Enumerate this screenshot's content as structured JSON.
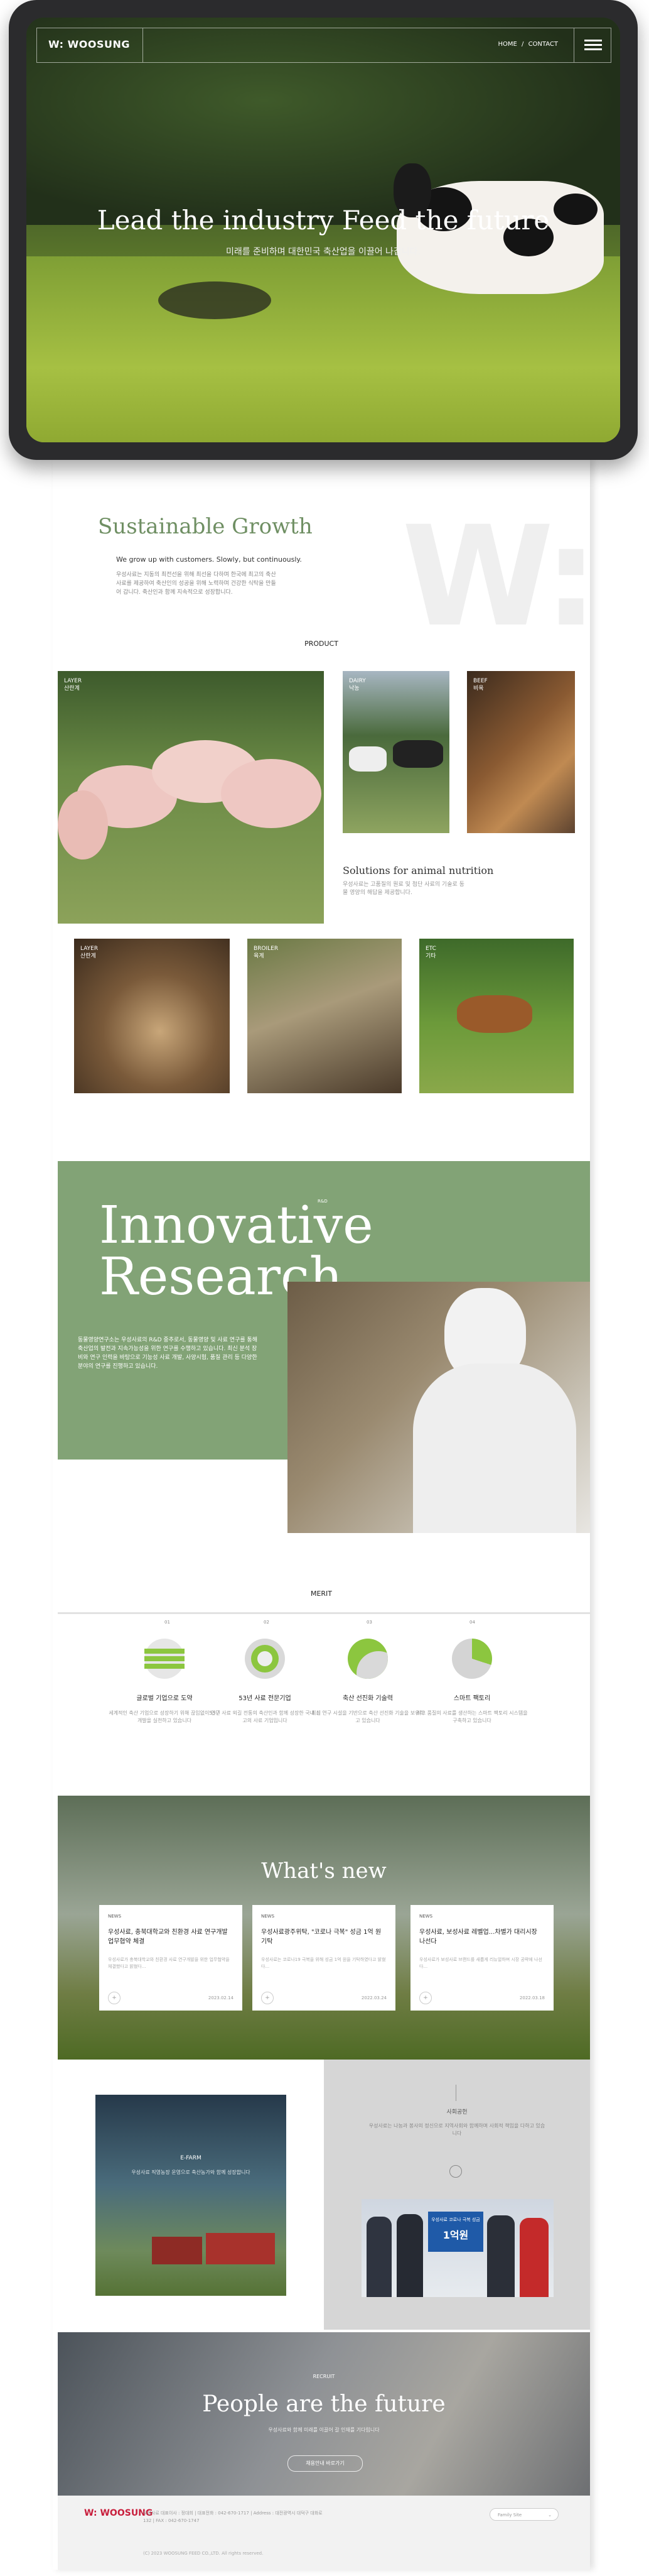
{
  "header": {
    "logo": "W: WOOSUNG",
    "nav_home": "HOME",
    "nav_sep": "/",
    "nav_contact": "CONTACT"
  },
  "hero": {
    "title": "Lead the industry Feed the future",
    "subtitle": "미래를 준비하며 대한민국 축산업을 이끌어 나갑니다."
  },
  "sustainable": {
    "watermark": "W:",
    "title": "Sustainable Growth",
    "subtitle": "We grow up with customers. Slowly, but continuously.",
    "body": "우성사료는 지동의 최전선을 위해 최선을 다하며 한국에 최고의 축산사료를 제공하여 축산인의 성공을 위해 노력하며 건강한 식탁을 만들어 갑니다. 축산인과 함께 지속적으로 성장합니다."
  },
  "product": {
    "label": "PRODUCT",
    "tiles": [
      {
        "en": "LAYER",
        "ko": "산란계"
      },
      {
        "en": "DAIRY",
        "ko": "낙농"
      },
      {
        "en": "BEEF",
        "ko": "비육"
      },
      {
        "en": "LAYER",
        "ko": "산란계"
      },
      {
        "en": "BROILER",
        "ko": "육계"
      },
      {
        "en": "ETC",
        "ko": "기타"
      }
    ],
    "solution_title": "Solutions for animal nutrition",
    "solution_body": "우성사료는 고품질의 원료 및 첨단 사료의 기술로 동물 영양의 해답을 제공합니다."
  },
  "research": {
    "small_label": "R&D",
    "title_line1": "Innovative",
    "title_line2": "Research",
    "body": "동물영양연구소는 우성사료의 R&D 중추로서, 동물영양 및 사료 연구를 통해 축산업의 발전과 지속가능성을 위한 연구를 수행하고 있습니다. 최신 분석 장비와 연구 인력을 바탕으로 기능성 사료 개발, 사양시험, 품질 관리 등 다양한 분야의 연구를 진행하고 있습니다."
  },
  "merit": {
    "label": "MERIT",
    "ticks": [
      "01",
      "02",
      "03",
      "04"
    ],
    "items": [
      {
        "icon": "stripes-icon",
        "title": "글로벌 기업으로 도약",
        "body": "세계적인 축산 기업으로 성장하기 위해 끊임없이 연구 개발을 실천하고 있습니다"
      },
      {
        "icon": "target-ring-icon",
        "title": "53년 사료 전문기업",
        "body": "53년 사료 외길 전통의 축산인과 함께 성장한 국내 최고의 사료 기업입니다"
      },
      {
        "icon": "swoosh-icon",
        "title": "축산 선진화 기술력",
        "body": "최신 연구 시설을 기반으로 축산 선진화 기술을 보유하고 있습니다"
      },
      {
        "icon": "pie-icon",
        "title": "스마트 팩토리",
        "body": "최고 품질의 사료를 생산하는 스마트 팩토리 시스템을 구축하고 있습니다"
      }
    ]
  },
  "news": {
    "title": "What's new",
    "cards": [
      {
        "tag": "NEWS",
        "title": "우성사료, 충북대학교와 친환경 사료 연구개발 업무협약 체결",
        "body": "우성사료가 충북대학교와 친환경 사료 연구개발을 위한 업무협약을 체결했다고 밝혔다...",
        "more": "+",
        "date": "2023.02.14"
      },
      {
        "tag": "NEWS",
        "title": "우성사료광주위탁, \"코로나 극복\" 성금 1억 원 기탁",
        "body": "우성사료는 코로나19 극복을 위해 성금 1억 원을 기탁하였다고 밝혔다...",
        "more": "+",
        "date": "2022.03.24"
      },
      {
        "tag": "NEWS",
        "title": "우성사료, 보성사료 레벨업...차별가 대리시장 나선다",
        "body": "우성사료가 보성사료 브랜드를 새롭게 리뉴얼하며 시장 공략에 나선다...",
        "more": "+",
        "date": "2022.03.18"
      }
    ]
  },
  "farm": {
    "label": "E-FARM",
    "body": "우성사료 직영농장 운영으로 축산농가와 함께 성장합니다"
  },
  "donate": {
    "label": "사회공헌",
    "body": "우성사료는 나눔과 봉사의 정신으로 지역사회와 함께하며 사회적 책임을 다하고 있습니다",
    "board_title": "우성사료 코로나 극복 성금",
    "board_amount": "1억원"
  },
  "recruit": {
    "label": "RECRUIT",
    "title": "People are the future",
    "body": "우성사료와 함께 미래를 이끌어 갈 인재를 기다립니다",
    "button": "채용안내 바로가기"
  },
  "footer": {
    "logo": "W: WOOSUNG",
    "info": "우성사료 대표이사 : 정대희  |  대표전화 : 042-670-1717  |  Address : 대전광역시 대덕구 대화로 132  |  FAX : 042-670-1747",
    "family_site": "Family Site",
    "copyright": "(C) 2023 WOOSUNG FEED CO.,LTD. All rights reserved."
  }
}
